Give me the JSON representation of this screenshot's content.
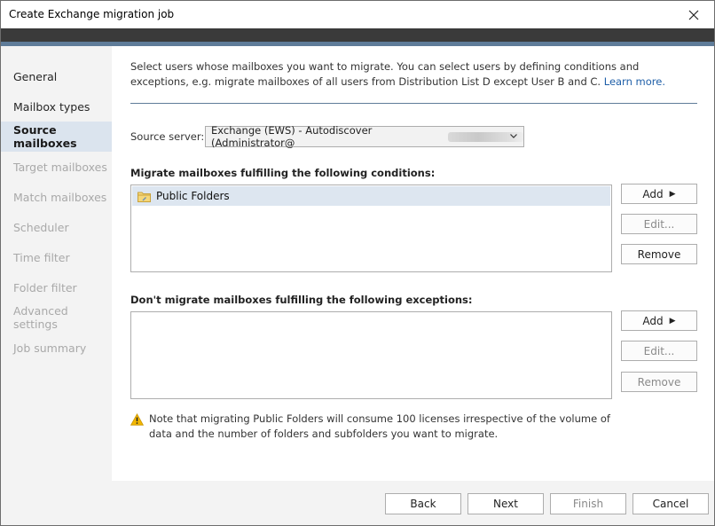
{
  "window": {
    "title": "Create Exchange migration job"
  },
  "sidebar": {
    "items": [
      {
        "label": "General",
        "state": "enabled"
      },
      {
        "label": "Mailbox types",
        "state": "enabled"
      },
      {
        "label": "Source mailboxes",
        "state": "selected"
      },
      {
        "label": "Target mailboxes",
        "state": "disabled"
      },
      {
        "label": "Match mailboxes",
        "state": "disabled"
      },
      {
        "label": "Scheduler",
        "state": "disabled"
      },
      {
        "label": "Time filter",
        "state": "disabled"
      },
      {
        "label": "Folder filter",
        "state": "disabled"
      },
      {
        "label": "Advanced settings",
        "state": "disabled"
      },
      {
        "label": "Job summary",
        "state": "disabled"
      }
    ]
  },
  "main": {
    "intro_text": "Select users whose mailboxes you want to migrate. You can select users by defining conditions and exceptions, e.g. migrate mailboxes of all users from Distribution List D except User B and C.",
    "learn_more": "Learn more.",
    "source_server": {
      "label": "Source server:",
      "value": "Exchange (EWS) - Autodiscover (Administrator@"
    },
    "conditions": {
      "heading": "Migrate mailboxes fulfilling the following conditions:",
      "items": [
        {
          "label": "Public Folders",
          "icon": "folder-icon"
        }
      ],
      "add_label": "Add",
      "edit_label": "Edit...",
      "remove_label": "Remove"
    },
    "exceptions": {
      "heading": "Don't migrate mailboxes fulfilling the following exceptions:",
      "add_label": "Add",
      "edit_label": "Edit...",
      "remove_label": "Remove"
    },
    "note": "Note that migrating Public Folders will consume 100 licenses irrespective of the volume of data and the number of folders and subfolders you want to migrate."
  },
  "footer": {
    "back": "Back",
    "next": "Next",
    "finish": "Finish",
    "cancel": "Cancel"
  },
  "colors": {
    "accent": "#5f7c99",
    "selected_nav": "#dbe4ee",
    "link": "#1f5fa8",
    "warning": "#f2b600"
  }
}
